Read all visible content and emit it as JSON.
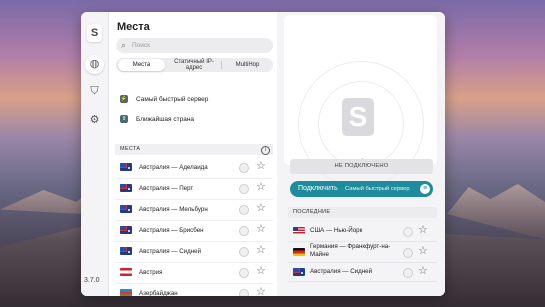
{
  "app": {
    "version": "3.7.0"
  },
  "sidebar": {
    "logo": "S",
    "icons": [
      "locations-globe-icon",
      "shield-icon",
      "settings-gear-icon"
    ]
  },
  "left": {
    "title": "Места",
    "search_placeholder": "Поиск",
    "tabs": [
      "Места",
      "Статичный IP-адрес",
      "MultiHop"
    ],
    "quick": [
      {
        "badge": "⚡",
        "label": "Самый быстрый сервер"
      },
      {
        "badge": "9",
        "label": "Ближайшая страна"
      }
    ],
    "section_label": "МЕСТА",
    "rows": [
      {
        "flag": "au",
        "name": "Австралия — Аделаида"
      },
      {
        "flag": "au",
        "name": "Австралия — Перт"
      },
      {
        "flag": "au",
        "name": "Австралия — Мельбурн"
      },
      {
        "flag": "au",
        "name": "Австралия — Брисбен"
      },
      {
        "flag": "au",
        "name": "Австралия — Сидней"
      },
      {
        "flag": "at",
        "name": "Австрия"
      },
      {
        "flag": "az",
        "name": "Азербайджан"
      }
    ]
  },
  "right": {
    "status": "НЕ ПОДКЛЮЧЕНО",
    "connect_label": "Подключить",
    "connect_target": "Самый быстрый сервер",
    "recent_label": "ПОСЛЕДНИЕ",
    "recent": [
      {
        "flag": "us",
        "name": "США — Нью-Йорк"
      },
      {
        "flag": "de",
        "name": "Германия — Франкфурт-на-Майне"
      },
      {
        "flag": "au",
        "name": "Австралия — Сидней"
      }
    ]
  },
  "colors": {
    "accent": "#1e8c9c"
  }
}
